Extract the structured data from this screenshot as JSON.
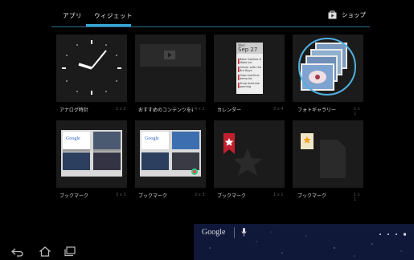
{
  "tabs": [
    {
      "label": "アプリ"
    },
    {
      "label": "ウィジェット"
    }
  ],
  "shop": {
    "label": "ショップ",
    "icon": "store-icon"
  },
  "widgets": [
    {
      "label": "アナログ時計",
      "size": "2 x 2",
      "icon": "analog-clock"
    },
    {
      "label": "おすすめのコンテンツを表示",
      "size": "4 x 2",
      "icon": "recommended-content"
    },
    {
      "label": "カレンダー",
      "size": "3 x 4",
      "icon": "calendar"
    },
    {
      "label": "フォトギャラリー",
      "size": "1 x 1",
      "icon": "photo-gallery"
    },
    {
      "label": "ブックマーク",
      "size": "3 x 3",
      "icon": "bookmarks-grid"
    },
    {
      "label": "ブックマーク",
      "size": "3 x 3",
      "icon": "bookmarks-list"
    },
    {
      "label": "ブックマーク",
      "size": "1 x 1",
      "icon": "bookmark-single"
    },
    {
      "label": "ブックマーク",
      "size": "1 x 1",
      "icon": "bookmark-file"
    }
  ],
  "calendar_preview": {
    "day": "Sep 27",
    "weekday": "Wed",
    "events": [
      "Bake Cookies & Make Ice Cream",
      "Dinner with the Bra Boys",
      "Drop machine demo for Sergio",
      "Shop machine opening"
    ]
  },
  "homescreen": {
    "search_label": "Google"
  },
  "colors": {
    "accent": "#35a7d6",
    "highlight_ring": "#4fb0e0"
  }
}
